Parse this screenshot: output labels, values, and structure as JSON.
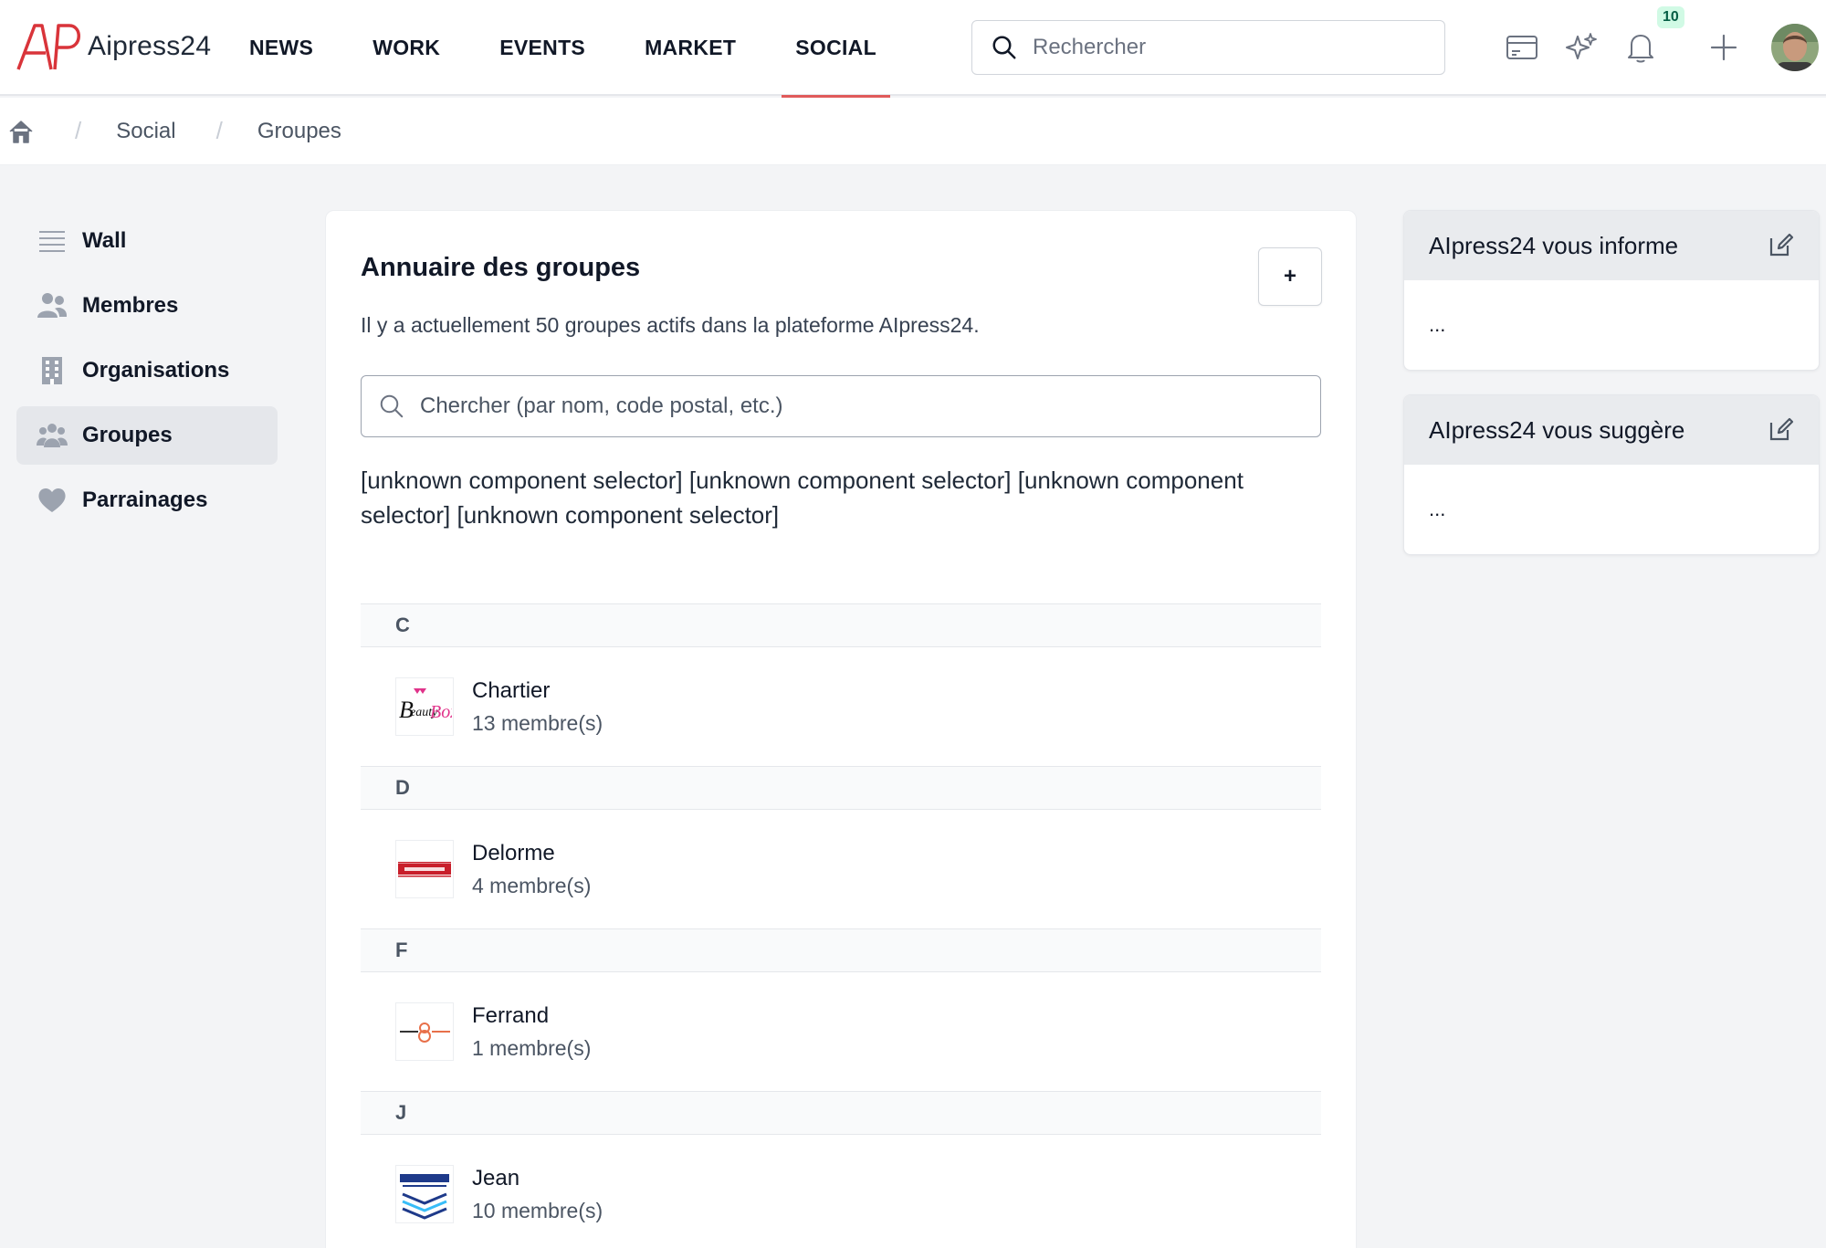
{
  "brand": {
    "name": "Aipress24",
    "accent": "#d9343a"
  },
  "nav": [
    {
      "label": "NEWS",
      "active": false
    },
    {
      "label": "WORK",
      "active": false
    },
    {
      "label": "EVENTS",
      "active": false
    },
    {
      "label": "MARKET",
      "active": false
    },
    {
      "label": "SOCIAL",
      "active": true
    }
  ],
  "search": {
    "placeholder": "Rechercher"
  },
  "notifications": {
    "count": "10"
  },
  "toolbar_icons": [
    "card-icon",
    "sparkles-icon",
    "bell-icon",
    "plus-icon"
  ],
  "breadcrumb": {
    "home_icon": "home-icon",
    "items": [
      "Social",
      "Groupes"
    ]
  },
  "sidebar": {
    "items": [
      {
        "label": "Wall",
        "icon": "list-icon",
        "active": false
      },
      {
        "label": "Membres",
        "icon": "users-icon",
        "active": false
      },
      {
        "label": "Organisations",
        "icon": "building-icon",
        "active": false
      },
      {
        "label": "Groupes",
        "icon": "group-icon",
        "active": true
      },
      {
        "label": "Parrainages",
        "icon": "heart-icon",
        "active": false
      }
    ]
  },
  "main": {
    "title": "Annuaire des groupes",
    "add_label": "+",
    "description": "Il y a actuellement 50 groupes actifs dans la plateforme AIpress24.",
    "search_placeholder": "Chercher (par nom, code postal, etc.)",
    "unknown_text": "[unknown component selector] [unknown component selector] [unknown component selector] [unknown component selector]",
    "groups": [
      {
        "letter": "C",
        "name": "Chartier",
        "members": "13 membre(s)",
        "logo": "beauty-box-logo"
      },
      {
        "letter": "D",
        "name": "Delorme",
        "members": "4 membre(s)",
        "logo": "petes-blinds-logo"
      },
      {
        "letter": "F",
        "name": "Ferrand",
        "members": "1 membre(s)",
        "logo": "yoga-baby-logo"
      },
      {
        "letter": "J",
        "name": "Jean",
        "members": "10 membre(s)",
        "logo": "james-sons-logo"
      }
    ]
  },
  "widgets": [
    {
      "title": "AIpress24 vous informe",
      "body": "..."
    },
    {
      "title": "AIpress24 vous suggère",
      "body": "..."
    }
  ]
}
